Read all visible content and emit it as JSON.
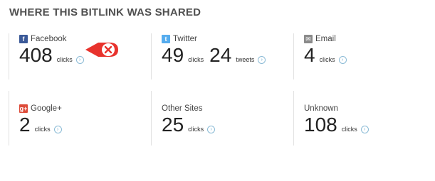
{
  "page_title": "WHERE THIS BITLINK WAS SHARED",
  "cards": [
    {
      "label": "Facebook",
      "icon": "facebook-icon",
      "count": "408",
      "unit": "clicks"
    },
    {
      "label": "Twitter",
      "icon": "twitter-icon",
      "count": "49",
      "unit": "clicks",
      "count2": "24",
      "unit2": "tweets"
    },
    {
      "label": "Email",
      "icon": "email-icon",
      "count": "4",
      "unit": "clicks"
    },
    {
      "label": "Google+",
      "icon": "google-plus-icon",
      "count": "2",
      "unit": "clicks"
    },
    {
      "label": "Other Sites",
      "count": "25",
      "unit": "clicks"
    },
    {
      "label": "Unknown",
      "count": "108",
      "unit": "clicks"
    }
  ],
  "colors": {
    "remove_badge": "#e8332d",
    "arrow": "#6aa6c8"
  }
}
